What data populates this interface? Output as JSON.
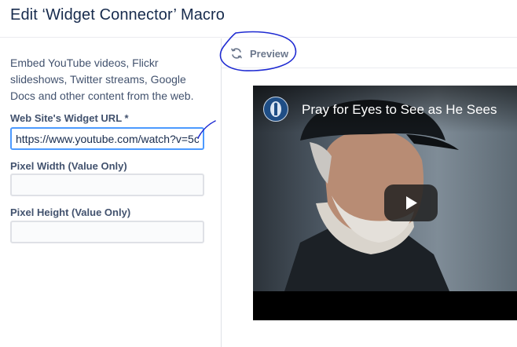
{
  "dialog": {
    "title": "Edit ‘Widget Connector’ Macro"
  },
  "form": {
    "description": "Embed YouTube videos, Flickr slideshows, Twitter streams, Google Docs and other content from the web.",
    "url_label": "Web Site's Widget URL *",
    "url_value": "https://www.youtube.com/watch?v=5c",
    "width_label": "Pixel Width (Value Only)",
    "width_value": "",
    "height_label": "Pixel Height (Value Only)",
    "height_value": ""
  },
  "preview": {
    "label": "Preview",
    "icon": "refresh-icon",
    "video": {
      "title": "Pray for Eyes to See as He Sees",
      "play_icon": "play-icon"
    }
  },
  "colors": {
    "focus_border": "#4c9aff",
    "annotation_ink": "#1e2ad2"
  }
}
